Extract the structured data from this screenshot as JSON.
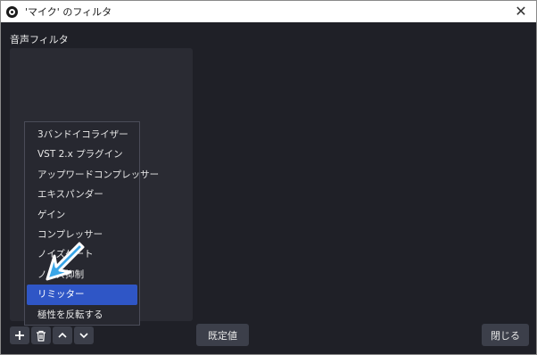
{
  "window": {
    "title": "'マイク' のフィルタ"
  },
  "section": {
    "audio_filters_label": "音声フィルタ"
  },
  "context_menu": {
    "items": [
      {
        "label": "3バンドイコライザー"
      },
      {
        "label": "VST 2.x プラグイン"
      },
      {
        "label": "アップワードコンプレッサー"
      },
      {
        "label": "エキスパンダー"
      },
      {
        "label": "ゲイン"
      },
      {
        "label": "コンプレッサー"
      },
      {
        "label": "ノイズゲート"
      },
      {
        "label": "ノイズ抑制"
      },
      {
        "label": "リミッター"
      },
      {
        "label": "極性を反転する"
      }
    ],
    "selected_index": 8
  },
  "buttons": {
    "defaults_label": "既定値",
    "close_label": "閉じる"
  },
  "icons": {
    "add": "plus-icon",
    "remove": "trash-icon",
    "move_up": "chevron-up-icon",
    "move_down": "chevron-down-icon",
    "pointer": "arrow-pointer-icon"
  },
  "colors": {
    "background": "#1f2027",
    "list_panel": "#2a2b33",
    "button": "#3c3f4a",
    "menu_highlight": "#2f56c6",
    "pointer_arrow": "#3aa6e8"
  }
}
